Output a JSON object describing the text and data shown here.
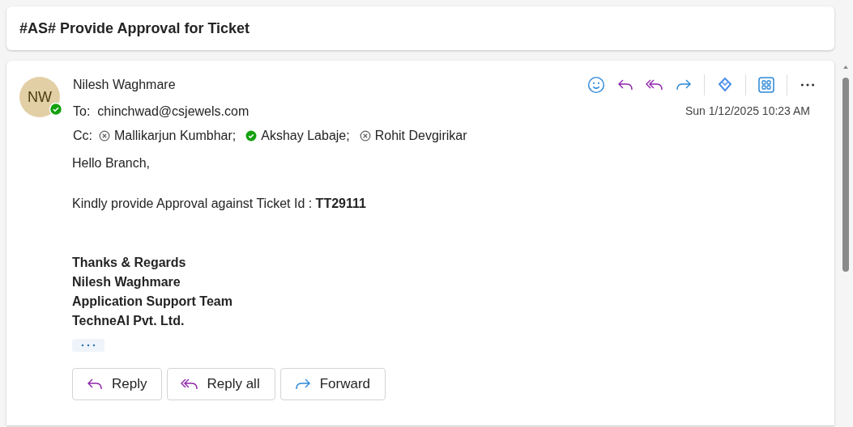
{
  "subject": "#AS# Provide Approval for Ticket",
  "message": {
    "sender": {
      "initials": "NW",
      "name": "Nilesh Waghmare",
      "available": true
    },
    "to_label": "To:",
    "to": "chinchwad@csjewels.com",
    "cc_label": "Cc:",
    "cc": [
      {
        "name": "Mallikarjun Kumbhar;",
        "available": false
      },
      {
        "name": "Akshay Labaje;",
        "available": true
      },
      {
        "name": "Rohit Devgirikar",
        "available": false
      }
    ],
    "date": "Sun 1/12/2025 10:23 AM",
    "body": {
      "greeting": "Hello Branch,",
      "text": "Kindly provide Approval against Ticket Id : **TT29111**",
      "signature": [
        "Thanks & Regards",
        "Nilesh Waghmare",
        "Application Support Team",
        "TechneAI Pvt. Ltd."
      ]
    },
    "buttons": [
      {
        "label": "Reply",
        "kind": "reply"
      },
      {
        "label": "Reply all",
        "kind": "reply-all"
      },
      {
        "label": "Forward",
        "kind": "forward"
      }
    ]
  }
}
